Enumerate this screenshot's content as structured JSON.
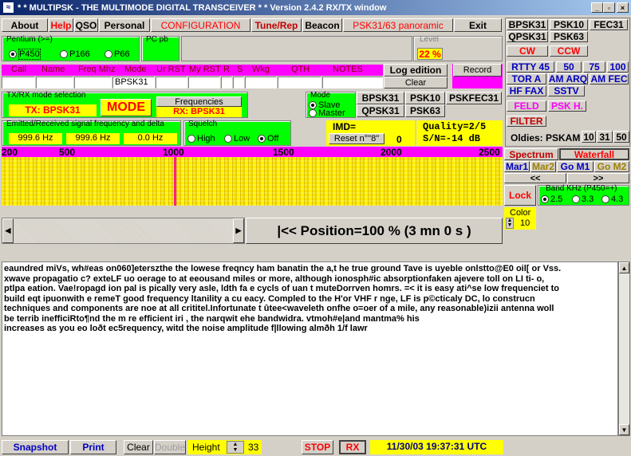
{
  "window": {
    "title": "* * MULTIPSK - THE MULTIMODE DIGITAL TRANSCEIVER * *  Version 2.4.2       RX/TX window",
    "min": "_",
    "restore": "▫",
    "close": "×"
  },
  "menu": [
    "About",
    "Help",
    "QSO",
    "Personal",
    "CONFIGURATION",
    "Tune/Rep",
    "Beacon",
    "PSK31/63 panoramic",
    "Exit"
  ],
  "cpu": {
    "label": "Pentium (>=)",
    "options": [
      "P450",
      "P166",
      "P66"
    ],
    "selected": "P450"
  },
  "pcpb": {
    "label": "PC pb"
  },
  "level": {
    "label": "Level",
    "value": "22 %"
  },
  "log": {
    "headers": [
      "Call",
      "Name",
      "Freq Mhz",
      "Mode",
      "Ur RST",
      "My RST",
      "R",
      "S",
      "Wkg",
      "QTH",
      "NOTES"
    ],
    "mode_value": "BPSK31",
    "log_edition": "Log edition",
    "record": "Record",
    "clear": "Clear"
  },
  "txrx": {
    "label": "TX/RX mode selection",
    "tx": "TX: BPSK31",
    "mode_btn": "MODE",
    "freq_btn": "Frequencies",
    "rx": "RX: BPSK31"
  },
  "slave": {
    "label": "Mode",
    "options": [
      "Slave",
      "Master"
    ],
    "selected": "Slave"
  },
  "quickmodes": [
    "BPSK31",
    "PSK10",
    "PSKFEC31",
    "QPSK31",
    "PSK63"
  ],
  "emitted": {
    "label": "Emitted/Received signal frequency and delta",
    "v1": "999.6 Hz",
    "v2": "999.6 Hz",
    "v3": "0.0 Hz"
  },
  "squelch": {
    "label": "Squelch",
    "options": [
      "High",
      "Low",
      "Off"
    ],
    "selected": "Off"
  },
  "imd": {
    "label": "IMD=",
    "reset": "Reset n°\"8\"",
    "count": "0",
    "quality": "Quality=2/5",
    "sn": "S/N=-14  dB"
  },
  "scale": {
    "ticks": [
      "200",
      "500",
      "1000",
      "1500",
      "2000",
      "2500"
    ]
  },
  "position": {
    "text": "|<<  Position=100 % (3 mn 0 s )"
  },
  "right_modes": [
    [
      "BPSK31",
      "PSK10",
      "FEC31"
    ],
    [
      "QPSK31",
      "PSK63",
      ""
    ],
    [
      "CW",
      "CCW",
      ""
    ],
    [
      "RTTY 45",
      "50",
      "75",
      "100"
    ],
    [
      "TOR A",
      "AM ARQ",
      "AM FEC"
    ],
    [
      "HF FAX",
      "SSTV"
    ],
    [
      "FELD",
      "PSK H."
    ],
    [
      "FILTER"
    ]
  ],
  "oldies": {
    "label": "Oldies: PSKAM",
    "b1": "10",
    "b2": "31",
    "b3": "50"
  },
  "view": {
    "spectrum": "Spectrum",
    "waterfall": "Waterfall",
    "mar1": "Mar1",
    "mar2": "Mar2",
    "gom1": "Go M1",
    "gom2": "Go M2",
    "prev": "<<",
    "next": ">>",
    "lock": "Lock",
    "band_label": "Band KHz (P450=+)",
    "bands": [
      "2.5",
      "3.3",
      "4.3"
    ],
    "band_selected": "2.5",
    "color": "Color",
    "color_val": "10"
  },
  "rxtext": [
    "eaundred miVs, wh#eas on060]eterszthe the lowese freqncy ham banatin the a,t he true ground Tave is uyeble onlstto@E0 oil[ or Vss.",
    "xwave propagatio   c? exteLF uo oerage to at eeousand miles or more, although ionosph#ic absorptionfaken ajevere toll on LI ti- o,",
    "ptlpa eation. Vae!ropagd ion pal is pically very asle, ldth fa  e cycls of uan t muteDorrven homrs. =< it is easy ati^se low frequenciet to",
    "build eqt ipuonwith e remeT good frequency ltanility a cu eacy. Compled to the H'or VHF r nge, LF is p©cticaly DC, lo construcn",
    "techniques and components are noe at all crititel.Infortunate t ûtee<waveleth onfhe o=oer of a mile, any reasonable)izii antenna woll",
    "be terrib inefficiRto¶nd the m re efficient iri  , the narqwit ehe bandwidra. vtmoh#e|and mantma%  his",
    "increases as you  eo loðt ec5requency, witd the noise amplitude f|llowing almðh 1/f lawr"
  ],
  "bottom": {
    "snapshot": "Snapshot",
    "print": "Print",
    "clear": "Clear",
    "double": "Double",
    "height": "Height",
    "height_val": "33",
    "stop": "STOP",
    "rx": "RX",
    "datetime": "11/30/03 19:37:31 UTC"
  }
}
